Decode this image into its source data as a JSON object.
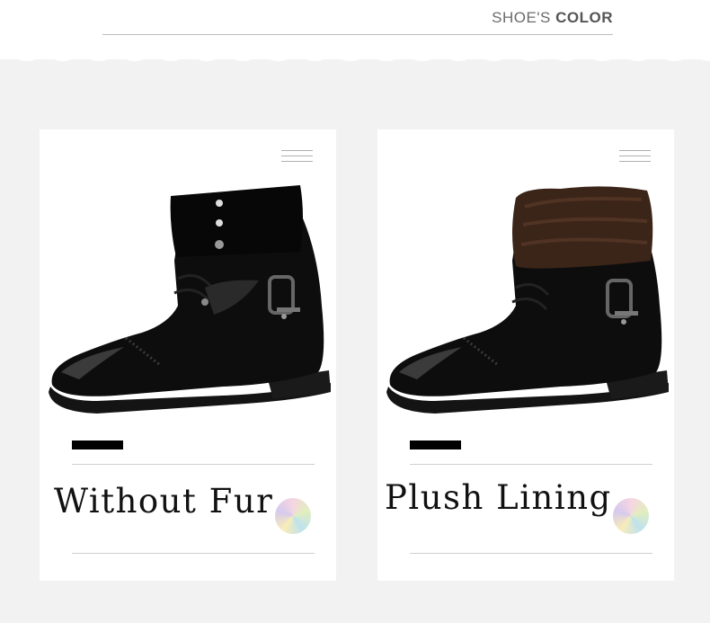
{
  "header": {
    "title_thin": "SHOE'S",
    "title_bold": "COLOR"
  },
  "cards": [
    {
      "label": "Without Fur",
      "variant": "no-fur"
    },
    {
      "label": "Plush Lining",
      "variant": "fur"
    }
  ],
  "colors": {
    "background": "#f2f2f2",
    "card": "#ffffff",
    "leather": "#111111",
    "fur": "#3b2418"
  }
}
